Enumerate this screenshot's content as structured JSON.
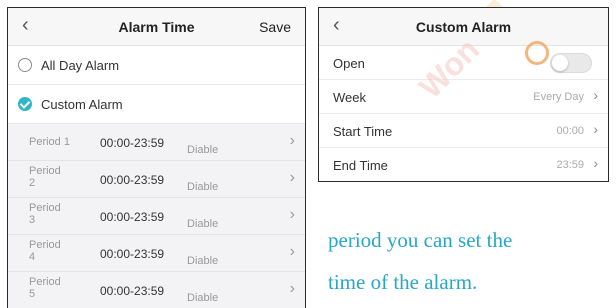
{
  "left_screen": {
    "back_icon": "chevron-left-icon",
    "title": "Alarm Time",
    "save_label": "Save",
    "options": [
      {
        "label": "All Day Alarm",
        "selected": false
      },
      {
        "label": "Custom Alarm",
        "selected": true
      }
    ],
    "periods": [
      {
        "name": "Period 1",
        "time": "00:00-23:59",
        "state": "Diable"
      },
      {
        "name": "Period 2",
        "time": "00:00-23:59",
        "state": "Diable"
      },
      {
        "name": "Period 3",
        "time": "00:00-23:59",
        "state": "Diable"
      },
      {
        "name": "Period 4",
        "time": "00:00-23:59",
        "state": "Diable"
      },
      {
        "name": "Period 5",
        "time": "00:00-23:59",
        "state": "Diable"
      }
    ],
    "accent_color": "#2fb6c9"
  },
  "right_screen": {
    "back_icon": "chevron-left-icon",
    "title": "Custom Alarm",
    "rows": {
      "open": {
        "label": "Open",
        "enabled": false
      },
      "week": {
        "label": "Week",
        "value": "Every Day"
      },
      "start_time": {
        "label": "Start Time",
        "value": "00:00"
      },
      "end_time": {
        "label": "End Time",
        "value": "23:59"
      }
    }
  },
  "document": {
    "line1": "period you can set the",
    "line2": "time of the alarm.",
    "text_color": "#27a7c5"
  },
  "watermark": {
    "text": "Won",
    "accent_color": "#f2a35a"
  }
}
